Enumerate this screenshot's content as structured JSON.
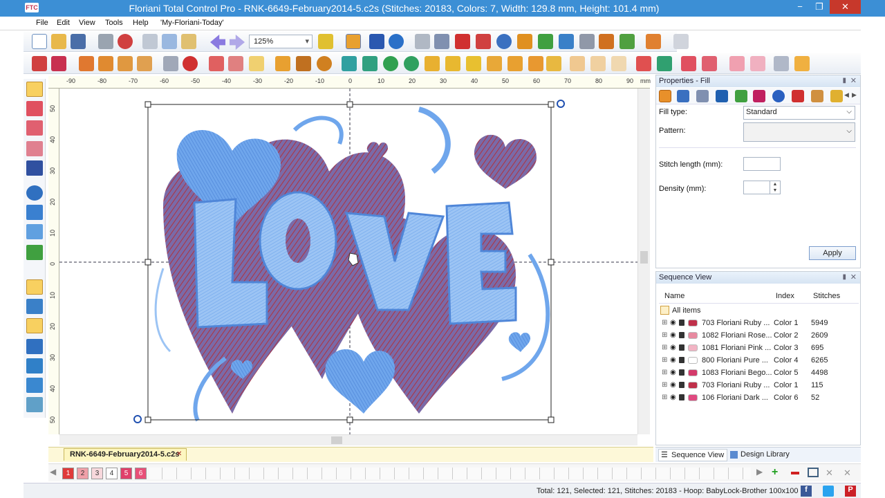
{
  "window": {
    "title": "Floriani Total Control Pro - RNK-6649-February2014-5.c2s (Stitches: 20183, Colors: 7, Width: 129.8 mm, Height: 101.4 mm)",
    "app_icon": "FTC",
    "minimize": "−",
    "restore": "❐",
    "close": "✕"
  },
  "menu": {
    "items": [
      "File",
      "Edit",
      "View",
      "Tools",
      "Help",
      "'My-Floriani-Today'"
    ]
  },
  "toolbar": {
    "zoom_value": "125%",
    "zoom_arrow": "▾"
  },
  "rulers": {
    "top": [
      "-90",
      "-80",
      "-70",
      "-60",
      "-50",
      "-40",
      "-30",
      "-20",
      "-10",
      "0",
      "10",
      "20",
      "30",
      "40",
      "50",
      "60",
      "70",
      "80",
      "90"
    ],
    "top_unit": "mm",
    "left": [
      "50",
      "40",
      "30",
      "20",
      "10",
      "0",
      "10",
      "20",
      "30",
      "40",
      "50"
    ]
  },
  "design": {
    "text": "LOVE",
    "colors": {
      "light_blue": "#6fa6ec",
      "mid_blue": "#4f86d8",
      "red": "#b0323c",
      "purple": "#7a6aa8"
    }
  },
  "properties": {
    "header": "Properties - Fill",
    "fill_type_label": "Fill type:",
    "fill_type_value": "Standard",
    "pattern_label": "Pattern:",
    "pattern_value": "",
    "stitch_length_label": "Stitch length (mm):",
    "stitch_length_value": "",
    "density_label": "Density (mm):",
    "density_value": "",
    "apply_label": "Apply"
  },
  "sequence": {
    "header": "Sequence View",
    "columns": [
      "Name",
      "Index",
      "Stitches"
    ],
    "all_items": "All items",
    "rows": [
      {
        "name": "703 Floriani Ruby ...",
        "index": "Color 1",
        "stitches": "5949",
        "color": "#c0304a"
      },
      {
        "name": "1082 Floriani Rose...",
        "index": "Color 2",
        "stitches": "2609",
        "color": "#e88aa0"
      },
      {
        "name": "1081 Floriani Pink ...",
        "index": "Color 3",
        "stitches": "695",
        "color": "#f2b4c4"
      },
      {
        "name": "800 Floriani Pure ...",
        "index": "Color 4",
        "stitches": "6265",
        "color": "#ffffff"
      },
      {
        "name": "1083 Floriani Bego...",
        "index": "Color 5",
        "stitches": "4498",
        "color": "#d43a6a"
      },
      {
        "name": "703 Floriani Ruby ...",
        "index": "Color 1",
        "stitches": "115",
        "color": "#c0304a"
      },
      {
        "name": "106 Floriani Dark ...",
        "index": "Color 6",
        "stitches": "52",
        "color": "#e04a80"
      }
    ]
  },
  "side_tabs": {
    "sequence": "Sequence View",
    "library": "Design Library"
  },
  "doc_tab": {
    "label": "RNK-6649-February2014-5.c2s",
    "close": "✕"
  },
  "color_swatches": [
    {
      "label": "1",
      "bg": "#e03a3a",
      "fg": "#ffffff"
    },
    {
      "label": "2",
      "bg": "#f0a0a8",
      "fg": "#333333"
    },
    {
      "label": "3",
      "bg": "#f8d8dc",
      "fg": "#333333"
    },
    {
      "label": "4",
      "bg": "#ffffff",
      "fg": "#333333"
    },
    {
      "label": "5",
      "bg": "#e0406a",
      "fg": "#ffffff"
    },
    {
      "label": "6",
      "bg": "#e85078",
      "fg": "#ffffff"
    }
  ],
  "status": {
    "text": "Total: 121, Selected: 121, Stitches: 20183 - Hoop: BabyLock-Brother 100x100"
  }
}
